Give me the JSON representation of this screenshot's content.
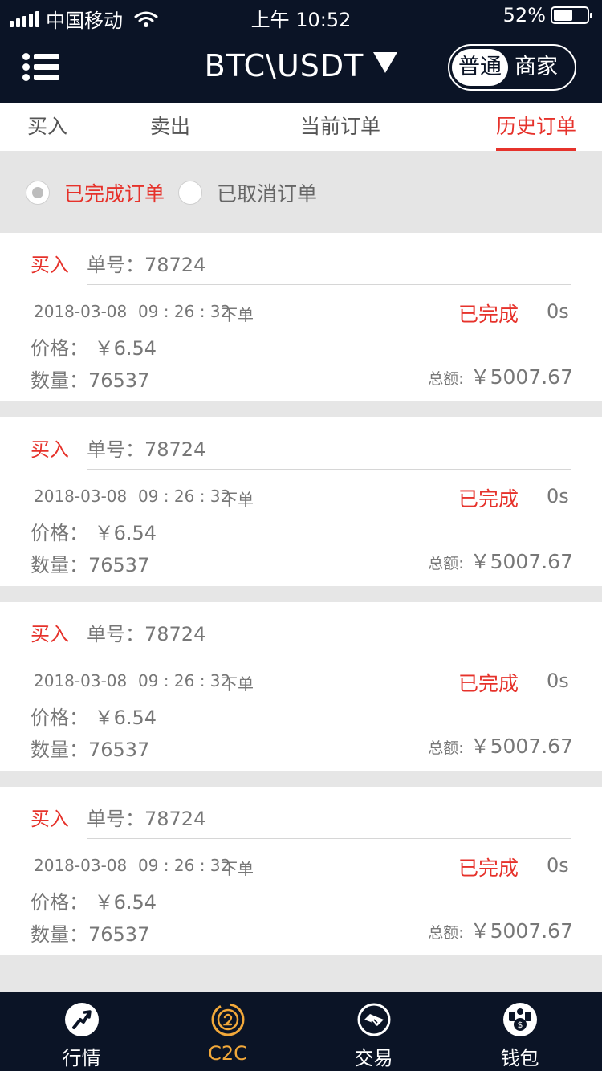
{
  "status_bar": {
    "carrier": "中国移动",
    "time": "上午 10:52",
    "battery": "52%"
  },
  "header": {
    "pair": "BTC\\USDT",
    "mode_options": [
      "普通",
      "商家"
    ],
    "active_mode": "普通"
  },
  "tabs": [
    {
      "label": "买入"
    },
    {
      "label": "卖出"
    },
    {
      "label": "当前订单"
    },
    {
      "label": "历史订单"
    }
  ],
  "filter": {
    "completed_label": "已完成订单",
    "canceled_label": "已取消订单"
  },
  "orders": [
    {
      "type": "买入",
      "order_no": "单号：78724",
      "date": "2018-03-08",
      "time": "09 : 26 : 32",
      "action": "下单",
      "status": "已完成",
      "duration": "0s",
      "price": "价格： ￥6.54",
      "quantity": "数量：76537",
      "total_label": "总额:",
      "total_value": "￥5007.67"
    },
    {
      "type": "买入",
      "order_no": "单号：78724",
      "date": "2018-03-08",
      "time": "09 : 26 : 32",
      "action": "下单",
      "status": "已完成",
      "duration": "0s",
      "price": "价格： ￥6.54",
      "quantity": "数量：76537",
      "total_label": "总额:",
      "total_value": "￥5007.67"
    },
    {
      "type": "买入",
      "order_no": "单号：78724",
      "date": "2018-03-08",
      "time": "09 : 26 : 32",
      "action": "下单",
      "status": "已完成",
      "duration": "0s",
      "price": "价格： ￥6.54",
      "quantity": "数量：76537",
      "total_label": "总额:",
      "total_value": "￥5007.67"
    },
    {
      "type": "买入",
      "order_no": "单号：78724",
      "date": "2018-03-08",
      "time": "09 : 26 : 32",
      "action": "下单",
      "status": "已完成",
      "duration": "0s",
      "price": "价格： ￥6.54",
      "quantity": "数量：76537",
      "total_label": "总额:",
      "total_value": "￥5007.67"
    }
  ],
  "bottom_nav": [
    {
      "label": "行情",
      "icon": "trend-icon"
    },
    {
      "label": "C2C",
      "icon": "c2c-icon"
    },
    {
      "label": "交易",
      "icon": "handshake-icon"
    },
    {
      "label": "钱包",
      "icon": "wallet-icon"
    }
  ],
  "colors": {
    "header_bg": "#0b1426",
    "accent_red": "#e6322b",
    "accent_gold": "#f2a83a"
  }
}
